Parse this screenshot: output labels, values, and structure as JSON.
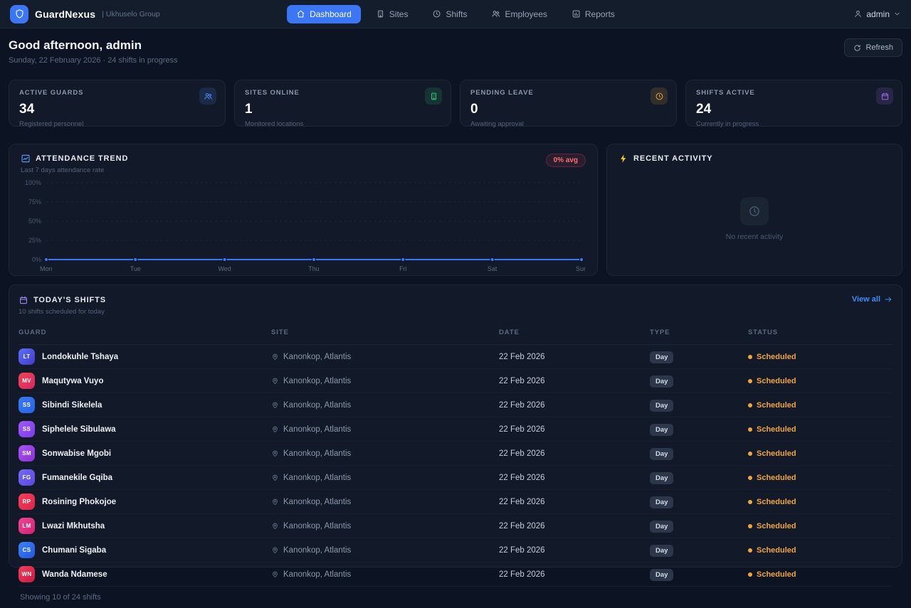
{
  "app": {
    "name": "GuardNexus",
    "org": "| Ukhuselo Group"
  },
  "nav": {
    "items": [
      {
        "label": "Dashboard",
        "icon": "home",
        "active": true
      },
      {
        "label": "Sites",
        "icon": "building",
        "active": false
      },
      {
        "label": "Shifts",
        "icon": "clock",
        "active": false
      },
      {
        "label": "Employees",
        "icon": "people",
        "active": false
      },
      {
        "label": "Reports",
        "icon": "barchart",
        "active": false
      }
    ],
    "user": "admin"
  },
  "header": {
    "greeting": "Good afternoon, admin",
    "subtitle": "Sunday, 22 February 2026 · 24 shifts in progress",
    "refresh_label": "Refresh"
  },
  "stats": [
    {
      "label": "ACTIVE GUARDS",
      "value": "34",
      "caption": "Registered personnel",
      "icon": "people",
      "color": "#4f8df7"
    },
    {
      "label": "SITES ONLINE",
      "value": "1",
      "caption": "Monitored locations",
      "icon": "building",
      "color": "#34c77b"
    },
    {
      "label": "PENDING LEAVE",
      "value": "0",
      "caption": "Awaiting approval",
      "icon": "clock",
      "color": "#e8a33d"
    },
    {
      "label": "SHIFTS ACTIVE",
      "value": "24",
      "caption": "Currently in progress",
      "icon": "calendar",
      "color": "#a06bf5"
    }
  ],
  "attendance": {
    "title": "ATTENDANCE TREND",
    "subtitle": "Last 7 days attendance rate",
    "badge": "0% avg"
  },
  "chart_data": {
    "type": "line",
    "x": [
      "Mon",
      "Tue",
      "Wed",
      "Thu",
      "Fri",
      "Sat",
      "Sun"
    ],
    "series": [
      {
        "name": "Attendance rate",
        "values": [
          0,
          0,
          0,
          0,
          0,
          0,
          0
        ]
      }
    ],
    "title": "ATTENDANCE TREND",
    "xlabel": "",
    "ylabel": "",
    "ylim": [
      0,
      100
    ],
    "yticks": [
      0,
      25,
      50,
      75,
      100
    ],
    "ytick_labels": [
      "0%",
      "25%",
      "50%",
      "75%",
      "100%"
    ],
    "grid": true,
    "legend": false,
    "line_color": "#3b76f6"
  },
  "activity": {
    "title": "RECENT ACTIVITY",
    "empty_text": "No recent activity"
  },
  "shifts": {
    "title": "TODAY'S SHIFTS",
    "subtitle": "10 shifts scheduled for today",
    "view_all_label": "View all",
    "columns": [
      "GUARD",
      "SITE",
      "DATE",
      "TYPE",
      "STATUS"
    ],
    "status_color": "#f0a53c",
    "footer": "Showing 10 of 24 shifts",
    "rows": [
      {
        "initials": "LT",
        "name": "Londokuhle Tshaya",
        "site": "Kanonkop, Atlantis",
        "date": "22 Feb 2026",
        "type": "Day",
        "status": "Scheduled",
        "c1": "#5b72f5",
        "c2": "#4438cc"
      },
      {
        "initials": "MV",
        "name": "Maqutywa Vuyo",
        "site": "Kanonkop, Atlantis",
        "date": "22 Feb 2026",
        "type": "Day",
        "status": "Scheduled",
        "c1": "#ef4455",
        "c2": "#d92662"
      },
      {
        "initials": "SS",
        "name": "Sibindi Sikelela",
        "site": "Kanonkop, Atlantis",
        "date": "22 Feb 2026",
        "type": "Day",
        "status": "Scheduled",
        "c1": "#3d7bf0",
        "c2": "#2563eb"
      },
      {
        "initials": "SS",
        "name": "Siphelele Sibulawa",
        "site": "Kanonkop, Atlantis",
        "date": "22 Feb 2026",
        "type": "Day",
        "status": "Scheduled",
        "c1": "#a05af5",
        "c2": "#7c3aed"
      },
      {
        "initials": "SM",
        "name": "Sonwabise Mgobi",
        "site": "Kanonkop, Atlantis",
        "date": "22 Feb 2026",
        "type": "Day",
        "status": "Scheduled",
        "c1": "#a855f7",
        "c2": "#8b2fd6"
      },
      {
        "initials": "FG",
        "name": "Fumanekile Gqiba",
        "site": "Kanonkop, Atlantis",
        "date": "22 Feb 2026",
        "type": "Day",
        "status": "Scheduled",
        "c1": "#766cf2",
        "c2": "#5b45e0"
      },
      {
        "initials": "RP",
        "name": "Rosining Phokojoe",
        "site": "Kanonkop, Atlantis",
        "date": "22 Feb 2026",
        "type": "Day",
        "status": "Scheduled",
        "c1": "#f43f5e",
        "c2": "#dc2645"
      },
      {
        "initials": "LM",
        "name": "Lwazi Mkhutsha",
        "site": "Kanonkop, Atlantis",
        "date": "22 Feb 2026",
        "type": "Day",
        "status": "Scheduled",
        "c1": "#ec4899",
        "c2": "#d61f70"
      },
      {
        "initials": "CS",
        "name": "Chumani Sigaba",
        "site": "Kanonkop, Atlantis",
        "date": "22 Feb 2026",
        "type": "Day",
        "status": "Scheduled",
        "c1": "#3b82f6",
        "c2": "#2456e0"
      },
      {
        "initials": "WN",
        "name": "Wanda Ndamese",
        "site": "Kanonkop, Atlantis",
        "date": "22 Feb 2026",
        "type": "Day",
        "status": "Scheduled",
        "c1": "#f43f5e",
        "c2": "#c91840"
      }
    ]
  }
}
